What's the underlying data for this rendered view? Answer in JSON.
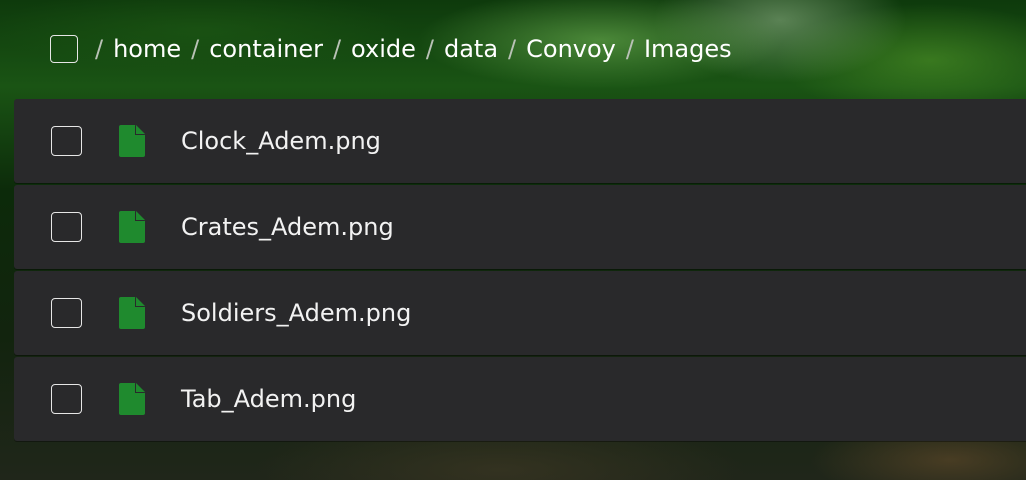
{
  "breadcrumb": {
    "separator": "/",
    "items": [
      "home",
      "container",
      "oxide",
      "data",
      "Convoy",
      "Images"
    ]
  },
  "files": [
    {
      "name": "Clock_Adem.png",
      "icon": "file-icon"
    },
    {
      "name": "Crates_Adem.png",
      "icon": "file-icon"
    },
    {
      "name": "Soldiers_Adem.png",
      "icon": "file-icon"
    },
    {
      "name": "Tab_Adem.png",
      "icon": "file-icon"
    }
  ],
  "colors": {
    "row_background": "#29292b",
    "file_icon": "#1f8a2e",
    "text": "#f2f2f2"
  }
}
